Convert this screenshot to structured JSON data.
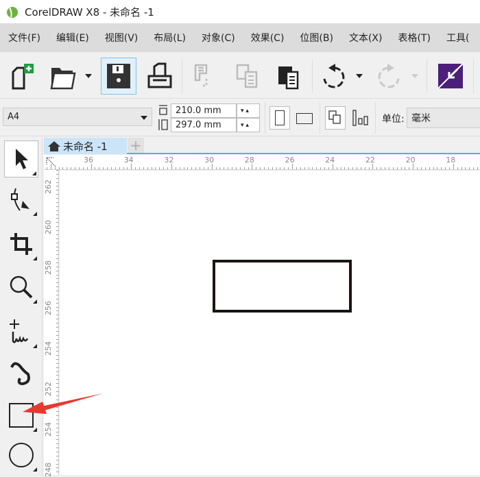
{
  "window": {
    "title": "CorelDRAW X8 - 未命名 -1"
  },
  "menu": [
    "文件(F)",
    "编辑(E)",
    "视图(V)",
    "布局(L)",
    "对象(C)",
    "效果(C)",
    "位图(B)",
    "文本(X)",
    "表格(T)",
    "工具("
  ],
  "toolbar": {
    "icons": [
      "new-document-icon",
      "open-folder-icon",
      "save-icon",
      "print-icon",
      "cut-icon",
      "copy-icon",
      "paste-icon",
      "undo-icon",
      "redo-icon",
      "import-icon"
    ]
  },
  "propbar": {
    "page_size": "A4",
    "width": "210.0 mm",
    "height": "297.0 mm",
    "units_label": "单位:",
    "units_value": "毫米"
  },
  "tab": {
    "label": "未命名 -1"
  },
  "ruler": {
    "top": [
      "36",
      "34",
      "32",
      "30",
      "28",
      "26",
      "24",
      "22",
      "20",
      "18"
    ],
    "left": [
      "262",
      "260",
      "258",
      "256",
      "254",
      "252",
      "254",
      "248"
    ]
  },
  "toolbox": [
    "pick-tool",
    "shape-tool",
    "crop-tool",
    "zoom-tool",
    "freehand-tool",
    "artistic-media-tool",
    "rectangle-tool",
    "ellipse-tool"
  ],
  "colors": {
    "accent": "#4ab4e6",
    "arrow": "#e8392f",
    "import": "#4b1f7a"
  }
}
